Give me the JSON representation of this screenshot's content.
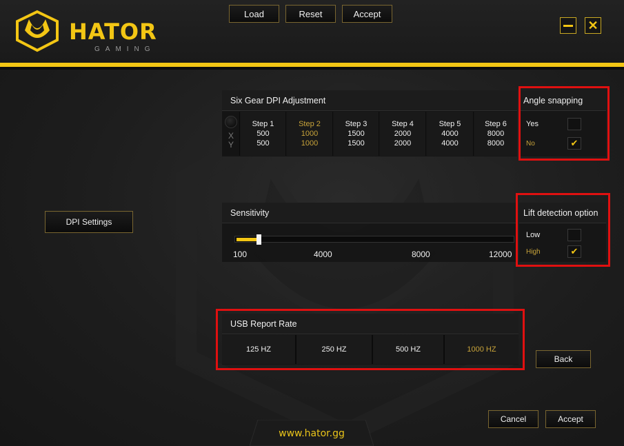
{
  "brand": {
    "name": "HATOR",
    "subtitle": "GAMING",
    "website": "www.hator.gg",
    "accent_color": "#f3c614",
    "selected_color": "#c9a43a",
    "highlight_color": "#e01010"
  },
  "toolbar": {
    "load_label": "Load",
    "reset_label": "Reset",
    "accept_label": "Accept"
  },
  "window_controls": {
    "minimize": "minimize-icon",
    "close": "close-icon"
  },
  "sidebar": {
    "dpi_settings_label": "DPI Settings"
  },
  "dpi_panel": {
    "title": "Six Gear DPI Adjustment",
    "x_label": "X",
    "y_label": "Y",
    "selected_step": 2,
    "steps": [
      {
        "label": "Step 1",
        "x": "500",
        "y": "500"
      },
      {
        "label": "Step 2",
        "x": "1000",
        "y": "1000"
      },
      {
        "label": "Step 3",
        "x": "1500",
        "y": "1500"
      },
      {
        "label": "Step 4",
        "x": "2000",
        "y": "2000"
      },
      {
        "label": "Step 5",
        "x": "4000",
        "y": "4000"
      },
      {
        "label": "Step 6",
        "x": "8000",
        "y": "8000"
      }
    ]
  },
  "angle_snapping": {
    "title": "Angle snapping",
    "options": [
      {
        "label": "Yes",
        "checked": false
      },
      {
        "label": "No",
        "checked": true
      }
    ]
  },
  "sensitivity": {
    "title": "Sensitivity",
    "min": 100,
    "max": 12000,
    "value": 1000,
    "ticks": [
      "100",
      "4000",
      "8000",
      "12000"
    ]
  },
  "lift_detection": {
    "title": "Lift detection option",
    "options": [
      {
        "label": "Low",
        "checked": false
      },
      {
        "label": "High",
        "checked": true
      }
    ]
  },
  "usb_report_rate": {
    "title": "USB Report Rate",
    "selected": "1000 HZ",
    "options": [
      "125 HZ",
      "250 HZ",
      "500 HZ",
      "1000 HZ"
    ]
  },
  "actions": {
    "back_label": "Back",
    "cancel_label": "Cancel",
    "accept_label": "Accept"
  }
}
